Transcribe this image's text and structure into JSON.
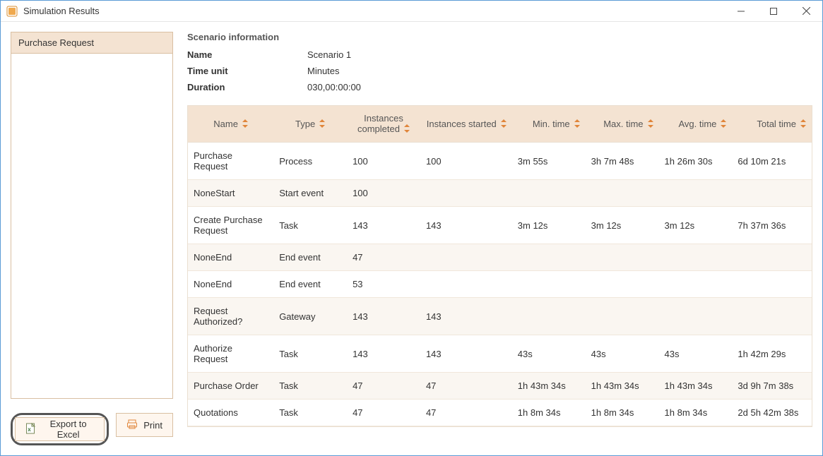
{
  "window": {
    "title": "Simulation Results"
  },
  "sidebar": {
    "items": [
      {
        "label": "Purchase Request"
      }
    ]
  },
  "buttons": {
    "export_label": "Export to Excel",
    "print_label": "Print"
  },
  "scenario": {
    "section_title": "Scenario information",
    "fields": {
      "name_label": "Name",
      "name_value": "Scenario 1",
      "time_unit_label": "Time unit",
      "time_unit_value": "Minutes",
      "duration_label": "Duration",
      "duration_value": "030,00:00:00"
    }
  },
  "table": {
    "headers": {
      "name": "Name",
      "type": "Type",
      "instances_completed": "Instances completed",
      "instances_started": "Instances started",
      "min_time": "Min. time",
      "max_time": "Max. time",
      "avg_time": "Avg. time",
      "total_time": "Total time"
    },
    "rows": [
      {
        "name": "Purchase Request",
        "type": "Process",
        "completed": "100",
        "started": "100",
        "min": "3m 55s",
        "max": "3h 7m 48s",
        "avg": "1h 26m 30s",
        "total": "6d 10m 21s"
      },
      {
        "name": "NoneStart",
        "type": "Start event",
        "completed": "100",
        "started": "",
        "min": "",
        "max": "",
        "avg": "",
        "total": ""
      },
      {
        "name": "Create Purchase Request",
        "type": "Task",
        "completed": "143",
        "started": "143",
        "min": "3m 12s",
        "max": "3m 12s",
        "avg": "3m 12s",
        "total": "7h 37m 36s"
      },
      {
        "name": "NoneEnd",
        "type": "End event",
        "completed": "47",
        "started": "",
        "min": "",
        "max": "",
        "avg": "",
        "total": ""
      },
      {
        "name": "NoneEnd",
        "type": "End event",
        "completed": "53",
        "started": "",
        "min": "",
        "max": "",
        "avg": "",
        "total": ""
      },
      {
        "name": "Request Authorized?",
        "type": "Gateway",
        "completed": "143",
        "started": "143",
        "min": "",
        "max": "",
        "avg": "",
        "total": ""
      },
      {
        "name": "Authorize Request",
        "type": "Task",
        "completed": "143",
        "started": "143",
        "min": "43s",
        "max": "43s",
        "avg": "43s",
        "total": "1h 42m 29s"
      },
      {
        "name": "Purchase Order",
        "type": "Task",
        "completed": "47",
        "started": "47",
        "min": "1h 43m 34s",
        "max": "1h 43m 34s",
        "avg": "1h 43m 34s",
        "total": "3d 9h 7m 38s"
      },
      {
        "name": "Quotations",
        "type": "Task",
        "completed": "47",
        "started": "47",
        "min": "1h 8m 34s",
        "max": "1h 8m 34s",
        "avg": "1h 8m 34s",
        "total": "2d 5h 42m 38s"
      }
    ]
  }
}
